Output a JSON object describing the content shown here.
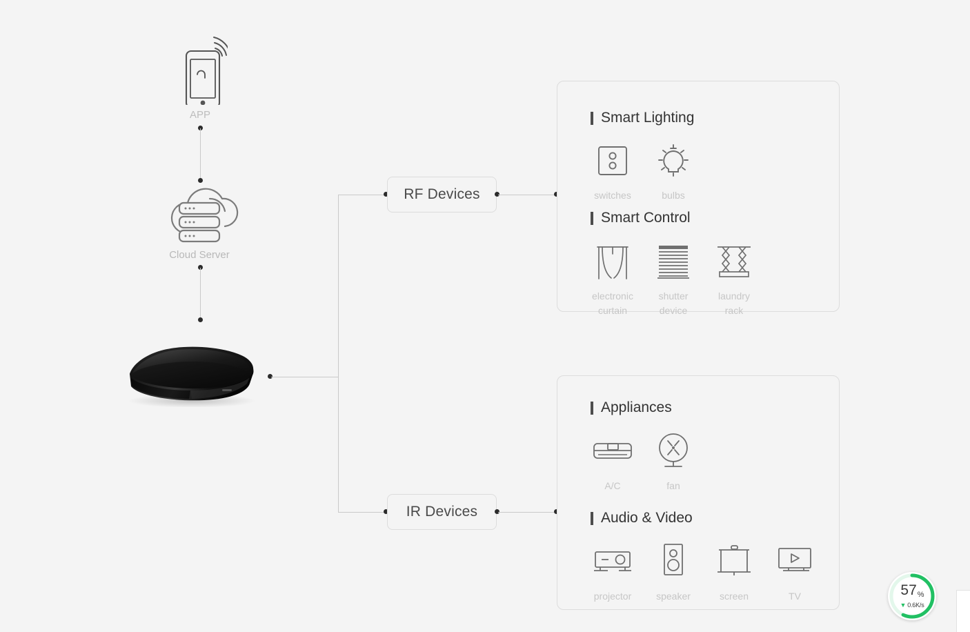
{
  "diagram": {
    "nodes": {
      "app": {
        "label": "APP",
        "icon": "smartphone-wifi-icon"
      },
      "cloud": {
        "label": "Cloud Server",
        "icon": "cloud-server-icon"
      },
      "hub": {
        "label": "",
        "icon": "smart-hub-device-image"
      },
      "rf": {
        "label": "RF Devices"
      },
      "ir": {
        "label": "IR Devices"
      }
    },
    "panels": [
      {
        "id": "rf-panel",
        "sections": [
          {
            "title": "Smart Lighting",
            "items": [
              {
                "caption": "switches",
                "icon": "wall-switch-icon"
              },
              {
                "caption": "bulbs",
                "icon": "light-bulb-icon"
              }
            ]
          },
          {
            "title": "Smart Control",
            "items": [
              {
                "caption": "electronic\ncurtain",
                "icon": "curtain-icon"
              },
              {
                "caption": "shutter\ndevice",
                "icon": "shutter-blinds-icon"
              },
              {
                "caption": "laundry\nrack",
                "icon": "laundry-rack-icon"
              }
            ]
          }
        ]
      },
      {
        "id": "ir-panel",
        "sections": [
          {
            "title": "Appliances",
            "items": [
              {
                "caption": "A/C",
                "icon": "air-conditioner-icon"
              },
              {
                "caption": "fan",
                "icon": "fan-icon"
              }
            ]
          },
          {
            "title": "Audio & Video",
            "items": [
              {
                "caption": "projector",
                "icon": "projector-icon"
              },
              {
                "caption": "speaker",
                "icon": "speaker-icon"
              },
              {
                "caption": "screen",
                "icon": "projection-screen-icon"
              },
              {
                "caption": "TV",
                "icon": "television-icon"
              }
            ]
          }
        ]
      }
    ]
  },
  "speed_widget": {
    "percent": "57",
    "percent_unit": "%",
    "rate": "0.6K/s",
    "direction_icon": "download-arrow-icon",
    "accent_color": "#21c063",
    "progress": 57
  },
  "colors": {
    "background": "#f4f4f4",
    "line": "#c9c9c9",
    "border": "#dcdcdc",
    "caption": "#c6c6c6",
    "heading": "#333333",
    "accent_green": "#21c063"
  }
}
